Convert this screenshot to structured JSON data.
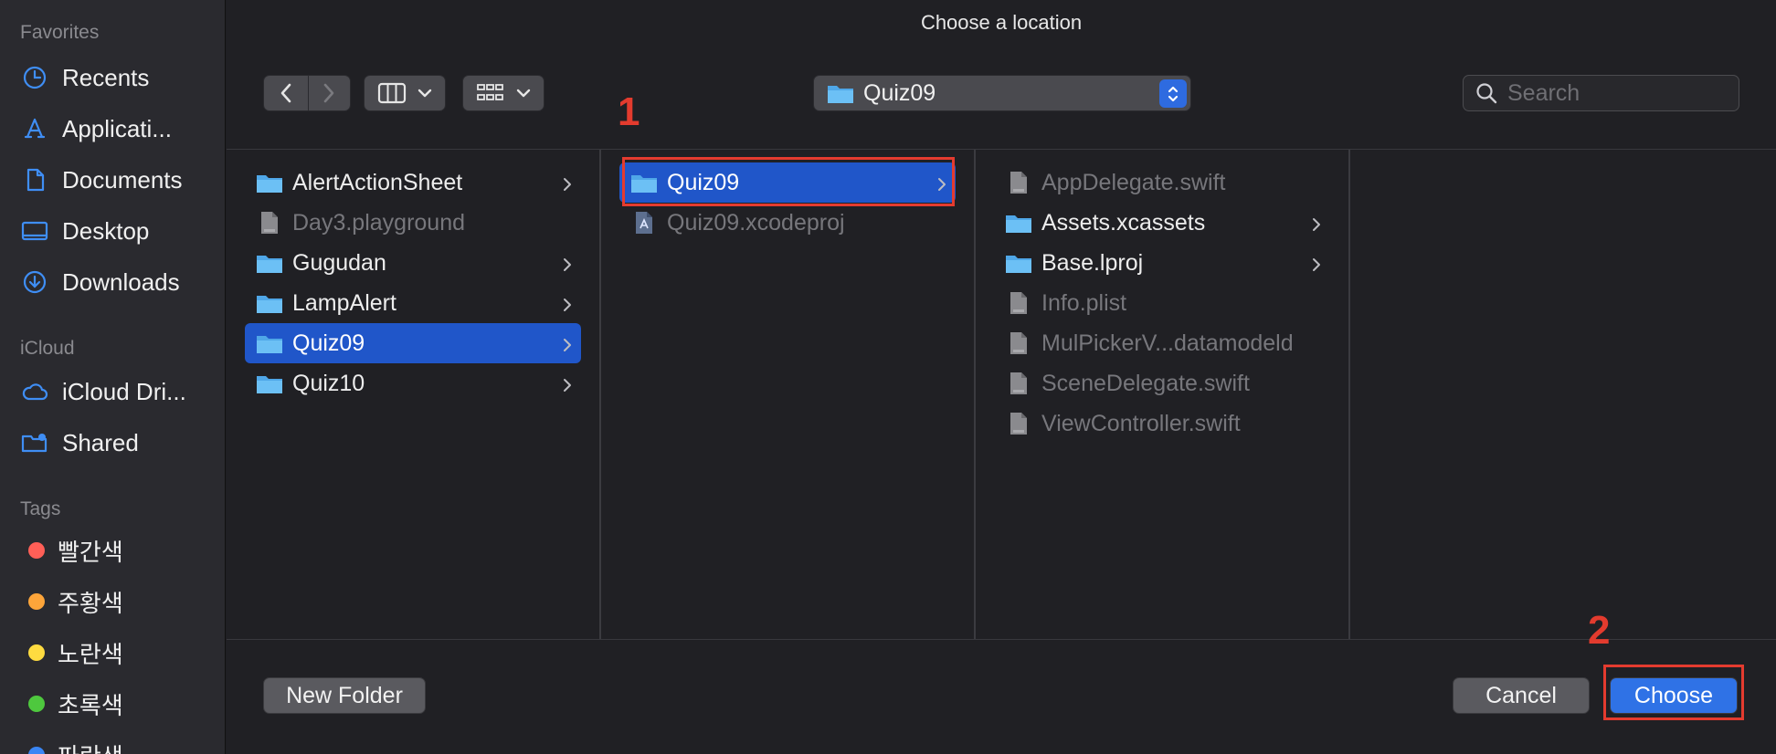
{
  "sidebar": {
    "favorites_header": "Favorites",
    "favorites": [
      {
        "label": "Recents",
        "icon": "clock-icon"
      },
      {
        "label": "Applicati...",
        "icon": "applications-icon"
      },
      {
        "label": "Documents",
        "icon": "document-icon"
      },
      {
        "label": "Desktop",
        "icon": "desktop-icon"
      },
      {
        "label": "Downloads",
        "icon": "download-icon"
      }
    ],
    "icloud_header": "iCloud",
    "icloud": [
      {
        "label": "iCloud Dri...",
        "icon": "cloud-icon"
      },
      {
        "label": "Shared",
        "icon": "shared-folder-icon"
      }
    ],
    "tags_header": "Tags",
    "tags": [
      {
        "label": "빨간색",
        "color": "#ff5f57"
      },
      {
        "label": "주황색",
        "color": "#fda53a"
      },
      {
        "label": "노란색",
        "color": "#fedb40"
      },
      {
        "label": "초록색",
        "color": "#4ec83e"
      },
      {
        "label": "파란색",
        "color": "#3a86f5"
      }
    ]
  },
  "dialog": {
    "title": "Choose a location",
    "location": "Quiz09",
    "search_placeholder": "Search"
  },
  "columns": [
    {
      "items": [
        {
          "label": "AlertActionSheet",
          "kind": "folder",
          "chevron": true
        },
        {
          "label": "Day3.playground",
          "kind": "file",
          "dim": true
        },
        {
          "label": "Gugudan",
          "kind": "folder",
          "chevron": true
        },
        {
          "label": "LampAlert",
          "kind": "folder",
          "chevron": true
        },
        {
          "label": "Quiz09",
          "kind": "folder",
          "chevron": true,
          "selected": true
        },
        {
          "label": "Quiz10",
          "kind": "folder",
          "chevron": true
        }
      ]
    },
    {
      "items": [
        {
          "label": "Quiz09",
          "kind": "folder",
          "chevron": true,
          "selected": true
        },
        {
          "label": "Quiz09.xcodeproj",
          "kind": "xcodeproj",
          "dim": true
        }
      ]
    },
    {
      "items": [
        {
          "label": "AppDelegate.swift",
          "kind": "file",
          "dim": true
        },
        {
          "label": "Assets.xcassets",
          "kind": "folder",
          "chevron": true
        },
        {
          "label": "Base.lproj",
          "kind": "folder",
          "chevron": true
        },
        {
          "label": "Info.plist",
          "kind": "file",
          "dim": true
        },
        {
          "label": "MulPickerV...datamodeld",
          "kind": "file",
          "dim": true
        },
        {
          "label": "SceneDelegate.swift",
          "kind": "file",
          "dim": true
        },
        {
          "label": "ViewController.swift",
          "kind": "file",
          "dim": true
        }
      ]
    }
  ],
  "annotations": {
    "step1": "1",
    "step2": "2"
  },
  "buttons": {
    "new_folder": "New Folder",
    "cancel": "Cancel",
    "choose": "Choose"
  },
  "colors": {
    "accent": "#2f72e6",
    "selection": "#2056c9",
    "annotation": "#e33b2e"
  }
}
